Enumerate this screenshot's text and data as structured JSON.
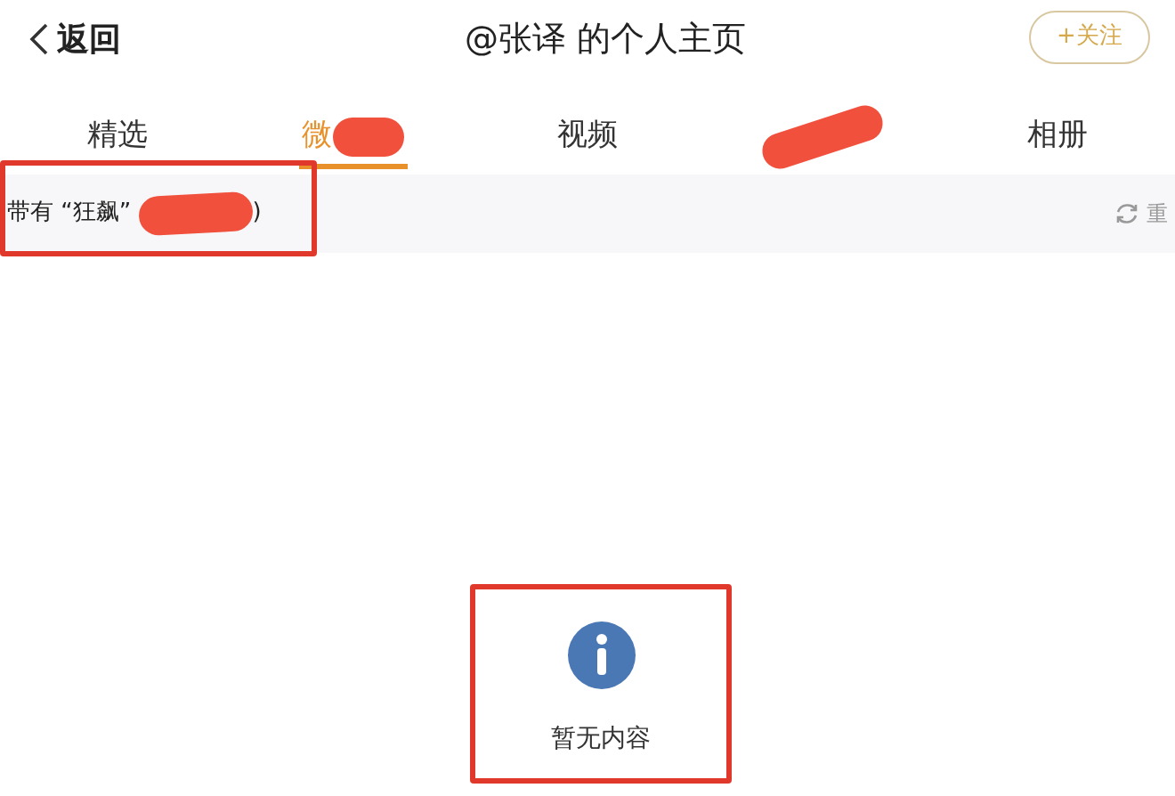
{
  "header": {
    "back_label": "返回",
    "title": "@张译 的个人主页",
    "follow_button": "+关注"
  },
  "tabs": [
    {
      "label": "精选",
      "selected": false,
      "redacted": false
    },
    {
      "label": "微",
      "selected": true,
      "redacted": true
    },
    {
      "label": "视频",
      "selected": false,
      "redacted": false
    },
    {
      "selected": false,
      "redacted": true
    },
    {
      "label": "相册",
      "selected": false,
      "redacted": false
    }
  ],
  "filter": {
    "text_before": "带有 “狂飙” ",
    "text_after": ")",
    "reset_label": "重"
  },
  "empty_state": {
    "message": "暂无内容"
  }
}
